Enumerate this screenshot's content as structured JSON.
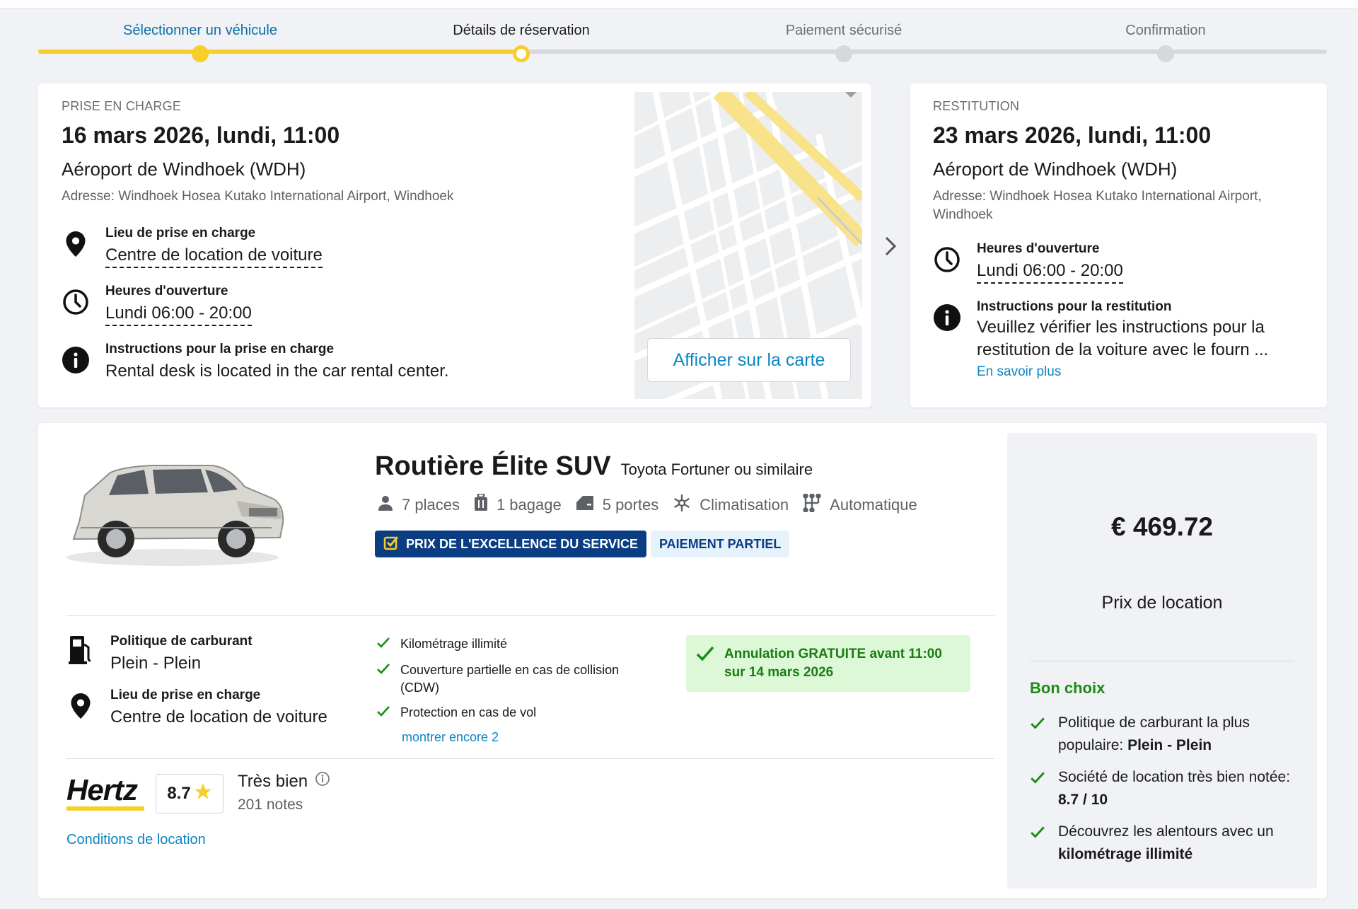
{
  "stepper": {
    "steps": [
      {
        "label": "Sélectionner un véhicule",
        "state": "done"
      },
      {
        "label": "Détails de réservation",
        "state": "current"
      },
      {
        "label": "Paiement sécurisé",
        "state": "pending"
      },
      {
        "label": "Confirmation",
        "state": "pending"
      }
    ]
  },
  "pickup": {
    "section_title": "PRISE EN CHARGE",
    "datetime": "16 mars 2026, lundi, 11:00",
    "location": "Aéroport de Windhoek (WDH)",
    "address": "Adresse: Windhoek Hosea Kutako International Airport, Windhoek",
    "place_heading": "Lieu de prise en charge",
    "place_value": "Centre de location de voiture",
    "hours_heading": "Heures d'ouverture",
    "hours_value": "Lundi 06:00 - 20:00",
    "instr_heading": "Instructions pour la prise en charge",
    "instr_value": "Rental desk is located in the car rental center.",
    "map_button": "Afficher sur la carte"
  },
  "return": {
    "section_title": "RESTITUTION",
    "datetime": "23 mars 2026, lundi, 11:00",
    "location": "Aéroport de Windhoek (WDH)",
    "address": "Adresse: Windhoek Hosea Kutako International Airport, Windhoek",
    "hours_heading": "Heures d'ouverture",
    "hours_value": "Lundi 06:00 - 20:00",
    "instr_heading": "Instructions pour la restitution",
    "instr_value": "Veuillez vérifier les instructions pour la restitution de la voiture avec le fourn ...",
    "more_link": "En savoir plus"
  },
  "car": {
    "name": "Routière Élite SUV",
    "model": "Toyota Fortuner ou similaire",
    "specs": {
      "seats": "7 places",
      "bags": "1 bagage",
      "doors": "5 portes",
      "ac": "Climatisation",
      "transmission": "Automatique"
    },
    "badge_excellence": "PRIX DE L'EXCELLENCE DU SERVICE",
    "badge_payment": "PAIEMENT PARTIEL",
    "fuel_heading": "Politique de carburant",
    "fuel_value": "Plein - Plein",
    "pickup_heading": "Lieu de prise en charge",
    "pickup_value": "Centre de location de voiture",
    "features": [
      "Kilométrage illimité",
      "Couverture partielle en cas de collision (CDW)",
      "Protection en cas de vol"
    ],
    "show_more": "montrer encore 2",
    "cancel_line1": "Annulation GRATUITE avant 11:00",
    "cancel_line2": "sur 14 mars 2026",
    "supplier_logo": "Hertz",
    "rating": "8.7",
    "rating_label": "Très bien",
    "rating_count": "201 notes",
    "conditions_link": "Conditions de location"
  },
  "price": {
    "amount": "€ 469.72",
    "label": "Prix de location",
    "good_choice": "Bon choix",
    "items": [
      {
        "text": "Politique de carburant la plus populaire: ",
        "bold": "Plein - Plein"
      },
      {
        "text": "Société de location très bien notée: ",
        "bold": "8.7 / 10"
      },
      {
        "text": "Découvrez les alentours avec un ",
        "bold": "kilométrage illimité"
      }
    ]
  },
  "colors": {
    "accent_yellow": "#f7ce2a",
    "link_blue": "#0a85c2",
    "badge_navy": "#0a3d82",
    "success_green": "#1a8c14"
  }
}
